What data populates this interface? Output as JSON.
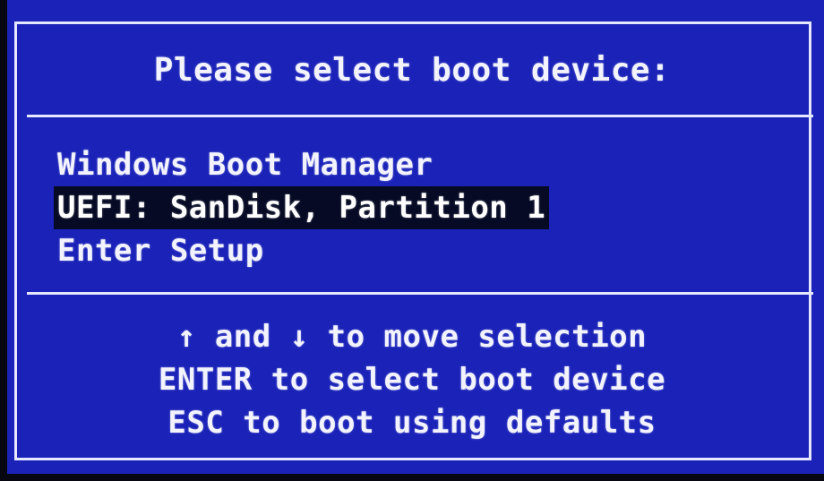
{
  "title": "Please select boot device:",
  "menu": {
    "items": [
      {
        "label": "Windows Boot Manager",
        "selected": false
      },
      {
        "label": "UEFI: SanDisk, Partition 1",
        "selected": true
      },
      {
        "label": "Enter Setup",
        "selected": false
      }
    ]
  },
  "help": {
    "lines": [
      "↑ and ↓ to move selection",
      "ENTER to select boot device",
      "ESC to boot using defaults"
    ]
  },
  "colors": {
    "background": "#1a22b8",
    "text": "#f2f3ff",
    "highlight": "#060a24"
  }
}
